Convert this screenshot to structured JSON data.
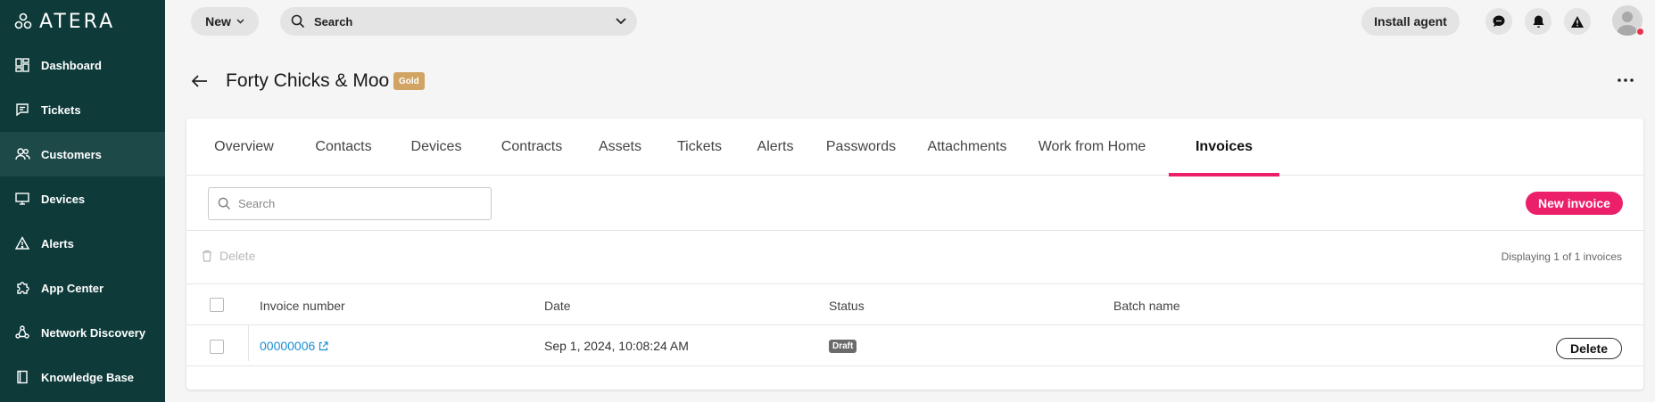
{
  "brand": {
    "name": "ATERA"
  },
  "sidebar": {
    "items": [
      {
        "label": "Dashboard",
        "icon": "dashboard-icon"
      },
      {
        "label": "Tickets",
        "icon": "ticket-icon"
      },
      {
        "label": "Customers",
        "icon": "customers-icon",
        "active": true
      },
      {
        "label": "Devices",
        "icon": "monitor-icon"
      },
      {
        "label": "Alerts",
        "icon": "alert-triangle-icon"
      },
      {
        "label": "App Center",
        "icon": "puzzle-icon"
      },
      {
        "label": "Network Discovery",
        "icon": "network-icon"
      },
      {
        "label": "Knowledge Base",
        "icon": "book-icon"
      }
    ]
  },
  "topbar": {
    "new_label": "New",
    "search_label": "Search",
    "install_label": "Install agent"
  },
  "header": {
    "title": "Forty Chicks & Moo",
    "badge": "Gold"
  },
  "tabs": [
    {
      "label": "Overview"
    },
    {
      "label": "Contacts"
    },
    {
      "label": "Devices"
    },
    {
      "label": "Contracts"
    },
    {
      "label": "Assets"
    },
    {
      "label": "Tickets"
    },
    {
      "label": "Alerts"
    },
    {
      "label": "Passwords"
    },
    {
      "label": "Attachments"
    },
    {
      "label": "Work from Home"
    },
    {
      "label": "Invoices",
      "active": true
    }
  ],
  "invoices": {
    "search_placeholder": "Search",
    "new_invoice_label": "New invoice",
    "delete_label": "Delete",
    "displaying_text": "Displaying 1 of 1 invoices",
    "columns": [
      "Invoice number",
      "Date",
      "Status",
      "Batch name"
    ],
    "rows": [
      {
        "invoice_number": "00000006",
        "date": "Sep 1, 2024, 10:08:24 AM",
        "status": "Draft",
        "batch_name": "",
        "action_label": "Delete"
      }
    ]
  },
  "colors": {
    "sidebar_bg": "#0e3b3a",
    "accent": "#ec1f6b",
    "gold": "#d2a463",
    "link": "#1a8fd0"
  }
}
